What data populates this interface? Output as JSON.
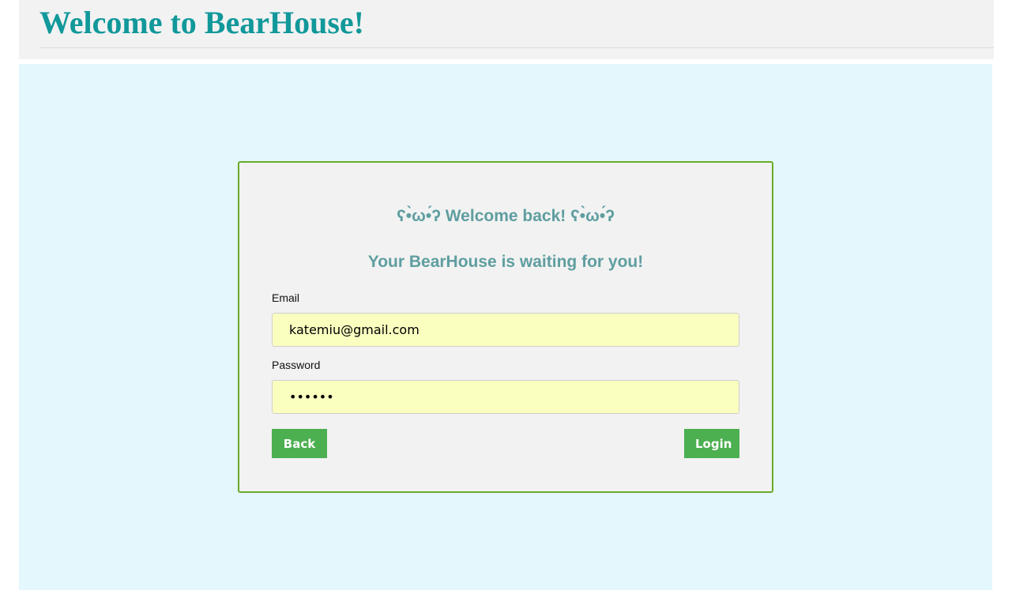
{
  "header": {
    "title": "Welcome to BearHouse!"
  },
  "login_card": {
    "greeting": "ʕ•̀ω•́ʔ Welcome back! ʕ•̀ω•́ʔ",
    "subtitle": "Your BearHouse is waiting for you!",
    "email_label": "Email",
    "email_value": "katemiu@gmail.com",
    "password_label": "Password",
    "password_value": "••••••",
    "back_label": "Back",
    "login_label": "Login"
  },
  "colors": {
    "title": "#11989a",
    "heading": "#5f9ea0",
    "card_border": "#6aaa2a",
    "button": "#4caf50",
    "input_bg": "#fafebf",
    "page_bg": "#e3f7fd"
  }
}
